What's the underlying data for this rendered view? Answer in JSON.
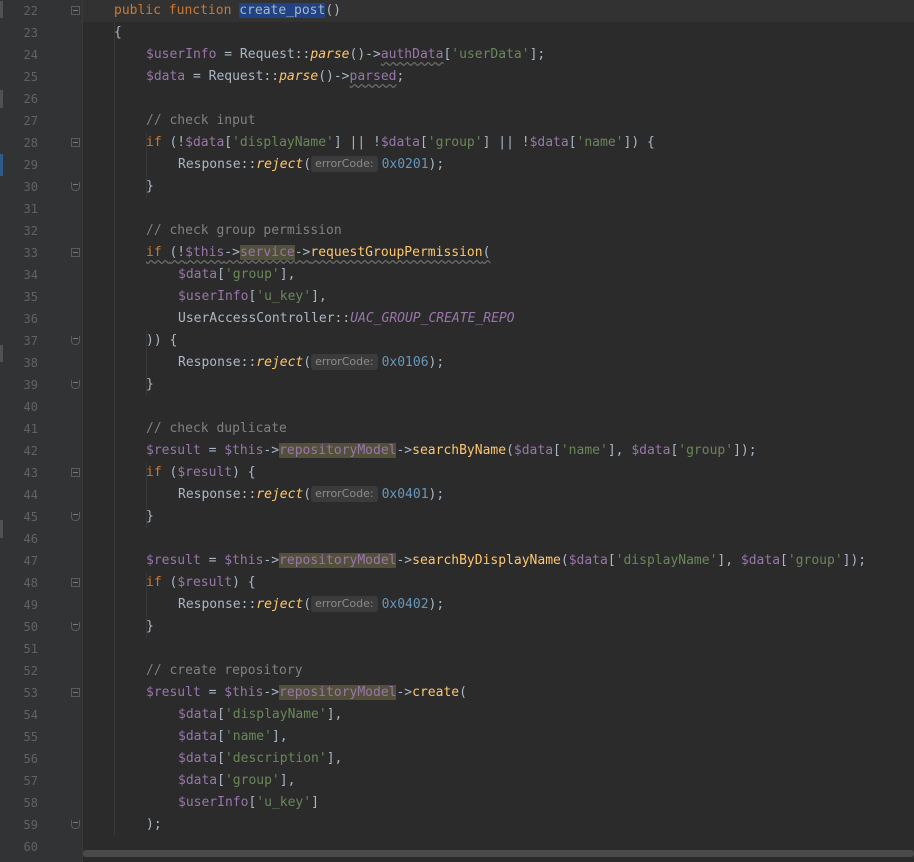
{
  "editor": {
    "language": "PHP",
    "lines": [
      {
        "n": "22",
        "indent": 0,
        "tokens": [
          [
            "kw",
            "public function "
          ],
          [
            "hl",
            "create_post"
          ],
          [
            "p",
            "()"
          ]
        ]
      },
      {
        "n": "23",
        "indent": 0,
        "tokens": [
          [
            "p",
            "{"
          ]
        ]
      },
      {
        "n": "24",
        "indent": 1,
        "tokens": [
          [
            "var",
            "$userInfo"
          ],
          [
            "p",
            " = Request::"
          ],
          [
            "mth",
            "parse"
          ],
          [
            "p",
            "()->"
          ],
          [
            "fieldw",
            "authData"
          ],
          [
            "p",
            "["
          ],
          [
            "str",
            "'userData'"
          ],
          [
            "p",
            "];"
          ]
        ]
      },
      {
        "n": "25",
        "indent": 1,
        "tokens": [
          [
            "var",
            "$data"
          ],
          [
            "p",
            " = Request::"
          ],
          [
            "mth",
            "parse"
          ],
          [
            "p",
            "()->"
          ],
          [
            "fieldw",
            "parsed"
          ],
          [
            "p",
            ";"
          ]
        ]
      },
      {
        "n": "26",
        "indent": 0,
        "tokens": []
      },
      {
        "n": "27",
        "indent": 1,
        "tokens": [
          [
            "cmt",
            "// check input"
          ]
        ]
      },
      {
        "n": "28",
        "indent": 1,
        "tokens": [
          [
            "kw",
            "if "
          ],
          [
            "p",
            "(!"
          ],
          [
            "var",
            "$data"
          ],
          [
            "p",
            "["
          ],
          [
            "str",
            "'displayName'"
          ],
          [
            "p",
            "] || !"
          ],
          [
            "var",
            "$data"
          ],
          [
            "p",
            "["
          ],
          [
            "str",
            "'group'"
          ],
          [
            "p",
            "] || !"
          ],
          [
            "var",
            "$data"
          ],
          [
            "p",
            "["
          ],
          [
            "str",
            "'name'"
          ],
          [
            "p",
            "]) {"
          ]
        ]
      },
      {
        "n": "29",
        "indent": 2,
        "tokens": [
          [
            "p",
            "Response::"
          ],
          [
            "mth",
            "reject"
          ],
          [
            "p",
            "("
          ],
          [
            "hint",
            "errorCode:"
          ],
          [
            "num",
            "0x0201"
          ],
          [
            "p",
            ");"
          ]
        ]
      },
      {
        "n": "30",
        "indent": 1,
        "tokens": [
          [
            "p",
            "}"
          ]
        ]
      },
      {
        "n": "31",
        "indent": 0,
        "tokens": []
      },
      {
        "n": "32",
        "indent": 1,
        "tokens": [
          [
            "cmt",
            "// check group permission"
          ]
        ]
      },
      {
        "n": "33",
        "indent": 1,
        "tokens": [
          [
            "kww",
            "if "
          ],
          [
            "pw",
            "(!"
          ],
          [
            "varw",
            "$this"
          ],
          [
            "pw",
            "->"
          ],
          [
            "fieldw2",
            "service"
          ],
          [
            "pw",
            "->"
          ],
          [
            "fnw",
            "requestGroupPermission"
          ],
          [
            "pw",
            "("
          ]
        ]
      },
      {
        "n": "34",
        "indent": 2,
        "tokens": [
          [
            "var",
            "$data"
          ],
          [
            "p",
            "["
          ],
          [
            "str",
            "'group'"
          ],
          [
            "p",
            "],"
          ]
        ]
      },
      {
        "n": "35",
        "indent": 2,
        "tokens": [
          [
            "var",
            "$userInfo"
          ],
          [
            "p",
            "["
          ],
          [
            "str",
            "'u_key'"
          ],
          [
            "p",
            "],"
          ]
        ]
      },
      {
        "n": "36",
        "indent": 2,
        "tokens": [
          [
            "p",
            "UserAccessController::"
          ],
          [
            "cst",
            "UAC_GROUP_CREATE_REPO"
          ]
        ]
      },
      {
        "n": "37",
        "indent": 1,
        "tokens": [
          [
            "p",
            ")) {"
          ]
        ]
      },
      {
        "n": "38",
        "indent": 2,
        "tokens": [
          [
            "p",
            "Response::"
          ],
          [
            "mth",
            "reject"
          ],
          [
            "p",
            "("
          ],
          [
            "hint",
            "errorCode:"
          ],
          [
            "num",
            "0x0106"
          ],
          [
            "p",
            ");"
          ]
        ]
      },
      {
        "n": "39",
        "indent": 1,
        "tokens": [
          [
            "p",
            "}"
          ]
        ]
      },
      {
        "n": "40",
        "indent": 0,
        "tokens": []
      },
      {
        "n": "41",
        "indent": 1,
        "tokens": [
          [
            "cmt",
            "// check duplicate"
          ]
        ]
      },
      {
        "n": "42",
        "indent": 1,
        "tokens": [
          [
            "var",
            "$result"
          ],
          [
            "p",
            " = "
          ],
          [
            "var",
            "$this"
          ],
          [
            "p",
            "->"
          ],
          [
            "field",
            "repositoryModel"
          ],
          [
            "p",
            "->"
          ],
          [
            "fn",
            "searchByName"
          ],
          [
            "p",
            "("
          ],
          [
            "var",
            "$data"
          ],
          [
            "p",
            "["
          ],
          [
            "str",
            "'name'"
          ],
          [
            "p",
            "], "
          ],
          [
            "var",
            "$data"
          ],
          [
            "p",
            "["
          ],
          [
            "str",
            "'group'"
          ],
          [
            "p",
            "]);"
          ]
        ]
      },
      {
        "n": "43",
        "indent": 1,
        "tokens": [
          [
            "kw",
            "if "
          ],
          [
            "p",
            "("
          ],
          [
            "var",
            "$result"
          ],
          [
            "p",
            ") {"
          ]
        ]
      },
      {
        "n": "44",
        "indent": 2,
        "tokens": [
          [
            "p",
            "Response::"
          ],
          [
            "mth",
            "reject"
          ],
          [
            "p",
            "("
          ],
          [
            "hint",
            "errorCode:"
          ],
          [
            "num",
            "0x0401"
          ],
          [
            "p",
            ");"
          ]
        ]
      },
      {
        "n": "45",
        "indent": 1,
        "tokens": [
          [
            "p",
            "}"
          ]
        ]
      },
      {
        "n": "46",
        "indent": 0,
        "tokens": []
      },
      {
        "n": "47",
        "indent": 1,
        "tokens": [
          [
            "var",
            "$result"
          ],
          [
            "p",
            " = "
          ],
          [
            "var",
            "$this"
          ],
          [
            "p",
            "->"
          ],
          [
            "field",
            "repositoryModel"
          ],
          [
            "p",
            "->"
          ],
          [
            "fn",
            "searchByDisplayName"
          ],
          [
            "p",
            "("
          ],
          [
            "var",
            "$data"
          ],
          [
            "p",
            "["
          ],
          [
            "str",
            "'displayName'"
          ],
          [
            "p",
            "], "
          ],
          [
            "var",
            "$data"
          ],
          [
            "p",
            "["
          ],
          [
            "str",
            "'group'"
          ],
          [
            "p",
            "]);"
          ]
        ]
      },
      {
        "n": "48",
        "indent": 1,
        "tokens": [
          [
            "kw",
            "if "
          ],
          [
            "p",
            "("
          ],
          [
            "var",
            "$result"
          ],
          [
            "p",
            ") {"
          ]
        ]
      },
      {
        "n": "49",
        "indent": 2,
        "tokens": [
          [
            "p",
            "Response::"
          ],
          [
            "mth",
            "reject"
          ],
          [
            "p",
            "("
          ],
          [
            "hint",
            "errorCode:"
          ],
          [
            "num",
            "0x0402"
          ],
          [
            "p",
            ");"
          ]
        ]
      },
      {
        "n": "50",
        "indent": 1,
        "tokens": [
          [
            "p",
            "}"
          ]
        ]
      },
      {
        "n": "51",
        "indent": 0,
        "tokens": []
      },
      {
        "n": "52",
        "indent": 1,
        "tokens": [
          [
            "cmt",
            "// create repository"
          ]
        ]
      },
      {
        "n": "53",
        "indent": 1,
        "tokens": [
          [
            "var",
            "$result"
          ],
          [
            "p",
            " = "
          ],
          [
            "var",
            "$this"
          ],
          [
            "p",
            "->"
          ],
          [
            "field",
            "repositoryModel"
          ],
          [
            "p",
            "->"
          ],
          [
            "fn",
            "create"
          ],
          [
            "p",
            "("
          ]
        ]
      },
      {
        "n": "54",
        "indent": 2,
        "tokens": [
          [
            "var",
            "$data"
          ],
          [
            "p",
            "["
          ],
          [
            "str",
            "'displayName'"
          ],
          [
            "p",
            "],"
          ]
        ]
      },
      {
        "n": "55",
        "indent": 2,
        "tokens": [
          [
            "var",
            "$data"
          ],
          [
            "p",
            "["
          ],
          [
            "str",
            "'name'"
          ],
          [
            "p",
            "],"
          ]
        ]
      },
      {
        "n": "56",
        "indent": 2,
        "tokens": [
          [
            "var",
            "$data"
          ],
          [
            "p",
            "["
          ],
          [
            "str",
            "'description'"
          ],
          [
            "p",
            "],"
          ]
        ]
      },
      {
        "n": "57",
        "indent": 2,
        "tokens": [
          [
            "var",
            "$data"
          ],
          [
            "p",
            "["
          ],
          [
            "str",
            "'group'"
          ],
          [
            "p",
            "],"
          ]
        ]
      },
      {
        "n": "58",
        "indent": 2,
        "tokens": [
          [
            "var",
            "$userInfo"
          ],
          [
            "p",
            "["
          ],
          [
            "str",
            "'u_key'"
          ],
          [
            "p",
            "]"
          ]
        ]
      },
      {
        "n": "59",
        "indent": 1,
        "tokens": [
          [
            "p",
            ");"
          ]
        ]
      },
      {
        "n": "60",
        "indent": 0,
        "tokens": []
      }
    ],
    "folds": {
      "22": "open",
      "28": "open",
      "30": "end",
      "33": "open",
      "37": "end",
      "39": "end",
      "43": "open",
      "45": "end",
      "48": "open",
      "50": "end",
      "53": "open",
      "59": "end"
    },
    "colors": {
      "background": "#2b2b2b",
      "gutter": "#313335",
      "keyword": "#cc7832",
      "variable": "#9876aa",
      "string": "#6a8759",
      "comment": "#808080",
      "number": "#6897bb",
      "function": "#ffc66d"
    }
  }
}
